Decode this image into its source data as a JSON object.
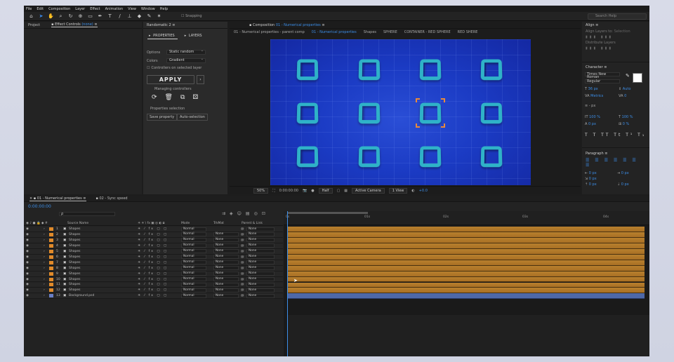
{
  "menu": [
    "File",
    "Edit",
    "Composition",
    "Layer",
    "Effect",
    "Animation",
    "View",
    "Window",
    "Help"
  ],
  "toolbar": {
    "snapping_label": "Snapping",
    "search_placeholder": "Search Help",
    "tools": [
      "home",
      "select",
      "hand",
      "zoom",
      "orbit",
      "rect",
      "pen",
      "type",
      "brush",
      "clone",
      "eraser",
      "roto",
      "pin"
    ]
  },
  "left_panel": {
    "project_tab": "Project",
    "effect_controls_tab": "Effect Controls",
    "effect_controls_target": "(none)"
  },
  "randomatic": {
    "title": "Randomatic 2",
    "tab_properties": "PROPERTIES",
    "tab_layers": "LAYERS",
    "options_label": "Options",
    "options_value": "Static random",
    "colors_label": "Colors",
    "colors_value": "Gradient",
    "controllers_label": "Controllers on selected layer",
    "apply_label": "APPLY",
    "more_label": "›",
    "managing_label": "Managing controllers",
    "selection_label": "Properties selection",
    "save_label": "Save property",
    "auto_label": "Auto-selection"
  },
  "composition": {
    "title": "Composition",
    "title_target": "01 - Numerical properties",
    "breadcrumbs": [
      "01 - Numerical properties - parent comp",
      "01 - Numerical properties",
      "Shapes",
      "SPHERE",
      "CONTAINER - RED SPHERE",
      "RED SHERE"
    ],
    "active_crumb_index": 1,
    "zoom": "50%",
    "timecode": "0:00:00:00",
    "resolution": "Half",
    "camera": "Active Camera",
    "view": "1 View",
    "exposure": "+0.0"
  },
  "right_panel": {
    "align_title": "Align",
    "align_layers_to": "Align Layers to:",
    "align_to_value": "Selection",
    "distribute_title": "Distribute Layers",
    "character_title": "Character",
    "font_name": "Times New Roman",
    "font_style": "Regular",
    "font_size": "36 px",
    "leading": "Auto",
    "kerning_label": "Metrics",
    "tracking": "0",
    "stroke_unit": "- px",
    "v_scale": "100 %",
    "h_scale": "100 %",
    "baseline": "0 px",
    "tsume": "0 %",
    "paragraph_title": "Paragraph",
    "indent_values": [
      "0 px",
      "0 px",
      "0 px",
      "0 px",
      "0 px"
    ]
  },
  "timeline": {
    "tab1": "01 - Numerical properties",
    "tab2": "02 - Sync speed",
    "timecode": "0:00:00:00",
    "search_placeholder": "ρ",
    "col_source": "Source Name",
    "col_mode": "Mode",
    "col_trkmat": "TrkMat",
    "col_parent": "Parent & Link",
    "ruler_labels": [
      "0s",
      "01s",
      "02s",
      "03s",
      "04s"
    ],
    "layers": [
      {
        "num": "1",
        "name": "Shapes",
        "mode": "Normal",
        "trk": "",
        "parent": "None",
        "color": "#e08a2a"
      },
      {
        "num": "2",
        "name": "Shapes",
        "mode": "Normal",
        "trk": "None",
        "parent": "None",
        "color": "#e08a2a"
      },
      {
        "num": "3",
        "name": "Shapes",
        "mode": "Normal",
        "trk": "None",
        "parent": "None",
        "color": "#e08a2a"
      },
      {
        "num": "4",
        "name": "Shapes",
        "mode": "Normal",
        "trk": "None",
        "parent": "None",
        "color": "#e08a2a"
      },
      {
        "num": "5",
        "name": "Shapes",
        "mode": "Normal",
        "trk": "None",
        "parent": "None",
        "color": "#e08a2a"
      },
      {
        "num": "6",
        "name": "Shapes",
        "mode": "Normal",
        "trk": "None",
        "parent": "None",
        "color": "#e08a2a"
      },
      {
        "num": "7",
        "name": "Shapes",
        "mode": "Normal",
        "trk": "None",
        "parent": "None",
        "color": "#e08a2a"
      },
      {
        "num": "8",
        "name": "Shapes",
        "mode": "Normal",
        "trk": "None",
        "parent": "None",
        "color": "#e08a2a"
      },
      {
        "num": "9",
        "name": "Shapes",
        "mode": "Normal",
        "trk": "None",
        "parent": "None",
        "color": "#e08a2a"
      },
      {
        "num": "10",
        "name": "Shapes",
        "mode": "Normal",
        "trk": "None",
        "parent": "None",
        "color": "#e08a2a"
      },
      {
        "num": "11",
        "name": "Shapes",
        "mode": "Normal",
        "trk": "None",
        "parent": "None",
        "color": "#e08a2a"
      },
      {
        "num": "12",
        "name": "Shapes",
        "mode": "Normal",
        "trk": "None",
        "parent": "None",
        "color": "#e08a2a"
      },
      {
        "num": "13",
        "name": "Background.psd",
        "mode": "Normal",
        "trk": "None",
        "parent": "None",
        "color": "#6a7fc6"
      }
    ]
  },
  "colors": {
    "accent": "#3c8ee8",
    "layer_bar": "#b07a2a",
    "background_bar": "#4e68a8",
    "viewport": "#1b3bc4",
    "shape": "#2fb2c8",
    "selection": "#e88a3a"
  }
}
